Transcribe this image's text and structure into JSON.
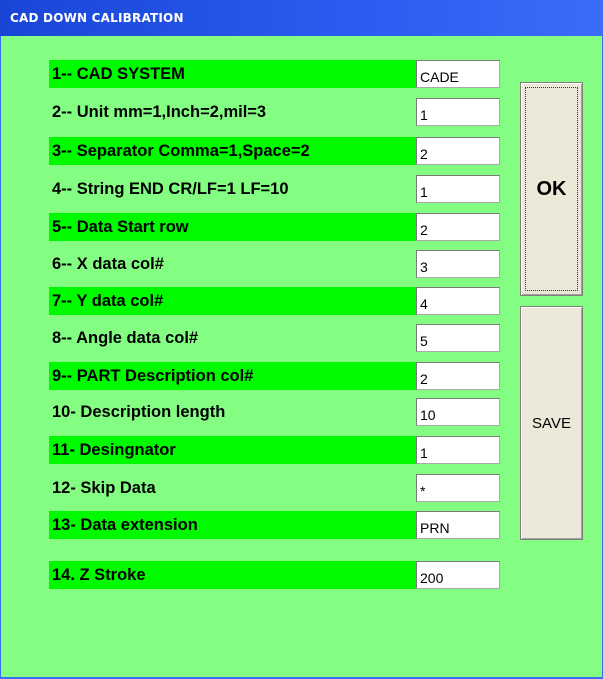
{
  "window": {
    "title": "CAD DOWN CALIBRATION"
  },
  "settings": [
    {
      "label": "1-- CAD SYSTEM",
      "value": "CADE"
    },
    {
      "label": "2-- Unit mm=1,Inch=2,mil=3",
      "value": "1"
    },
    {
      "label": "3-- Separator Comma=1,Space=2",
      "value": "2"
    },
    {
      "label": "4-- String END CR/LF=1 LF=10",
      "value": "1"
    },
    {
      "label": "5-- Data Start row",
      "value": "2"
    },
    {
      "label": "6-- X data col#",
      "value": "3"
    },
    {
      "label": "7-- Y data col#",
      "value": "4"
    },
    {
      "label": "8-- Angle data col#",
      "value": "5"
    },
    {
      "label": "9-- PART Description col#",
      "value": "2"
    },
    {
      "label": "10- Description length",
      "value": "10"
    },
    {
      "label": "11- Desingnator",
      "value": "1"
    },
    {
      "label": "12- Skip Data",
      "value": "*"
    },
    {
      "label": "13- Data extension",
      "value": "PRN"
    },
    {
      "label": "14. Z Stroke",
      "value": "200"
    }
  ],
  "buttons": {
    "ok": "OK",
    "save": "SAVE"
  },
  "colors": {
    "highlight": "#00fa00",
    "background": "#83fe83",
    "titlebar": "#2a5df0"
  }
}
